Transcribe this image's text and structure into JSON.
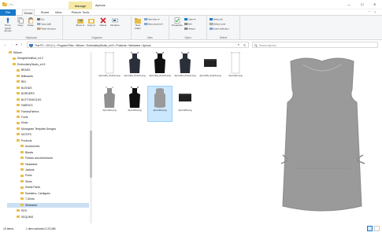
{
  "window": {
    "title": "Aprons",
    "context_tab": "Manage",
    "controls": {
      "minimize": "—",
      "maximize": "☐",
      "close": "✕"
    }
  },
  "ribbon_tabs": [
    "File",
    "Home",
    "Share",
    "View",
    "Picture Tools"
  ],
  "ribbon": {
    "clipboard": {
      "pin": "Pin to Quick access",
      "copy": "Copy",
      "paste": "Paste",
      "cut": "Cut",
      "copy_path": "Copy path",
      "paste_shortcut": "Paste shortcut",
      "label": "Clipboard"
    },
    "organize": {
      "move_to": "Move to",
      "copy_to": "Copy to",
      "delete": "Delete",
      "rename": "Rename",
      "label": "Organize"
    },
    "new": {
      "new_folder": "New folder",
      "new_item": "New item ▾",
      "easy_access": "Easy access ▾",
      "label": "New"
    },
    "open": {
      "properties": "Properties",
      "open": "Open ▾",
      "edit": "Edit",
      "history": "History",
      "label": "Open"
    },
    "select": {
      "select_all": "Select all",
      "select_none": "Select none",
      "invert": "Invert selection",
      "label": "Select"
    }
  },
  "nav": {
    "back": "←",
    "forward": "→",
    "recent": "▾",
    "up": "↑",
    "breadcrumb": [
      "This PC",
      "OS (C:)",
      "Program Files",
      "Wilcom",
      "EmbroideryStudio_e4.5",
      "Products",
      "Workwear",
      "Aprons"
    ],
    "refresh": "↻",
    "search_placeholder": "Search Aprons"
  },
  "tree": [
    {
      "label": "Wilcom",
      "depth": 0
    },
    {
      "label": "DesignWorkflow_e4.2",
      "depth": 1
    },
    {
      "label": "EmbroideryStudio_e4.5",
      "depth": 1
    },
    {
      "label": "BEADS",
      "depth": 2
    },
    {
      "label": "Billboards",
      "depth": 2
    },
    {
      "label": "BIN",
      "depth": 2
    },
    {
      "label": "BLENDS",
      "depth": 2
    },
    {
      "label": "BORDERS",
      "depth": 2
    },
    {
      "label": "BUTTONHOLES",
      "depth": 2
    },
    {
      "label": "FABRICS",
      "depth": 2
    },
    {
      "label": "FactoryFabrics",
      "depth": 2
    },
    {
      "label": "Fonts",
      "depth": 2
    },
    {
      "label": "Kiosk",
      "depth": 2
    },
    {
      "label": "Monogram Template Designs",
      "depth": 2
    },
    {
      "label": "MOTIFS",
      "depth": 2
    },
    {
      "label": "Products",
      "depth": 2
    },
    {
      "label": "Accessories",
      "depth": 3
    },
    {
      "label": "Blanks",
      "depth": 3
    },
    {
      "label": "Fitness and Activewear",
      "depth": 3
    },
    {
      "label": "Headwear",
      "depth": 3
    },
    {
      "label": "Jackets",
      "depth": 3
    },
    {
      "label": "Polos",
      "depth": 3
    },
    {
      "label": "Shirts",
      "depth": 3
    },
    {
      "label": "Sweat Pants",
      "depth": 3
    },
    {
      "label": "Sweaters- Cardigans",
      "depth": 3
    },
    {
      "label": "T-Shirts",
      "depth": 3
    },
    {
      "label": "Workwear",
      "depth": 3,
      "selected": true
    },
    {
      "label": "RES",
      "depth": 2
    },
    {
      "label": "SEQUINS",
      "depth": 2
    }
  ],
  "files": [
    {
      "name": "Apron01_thumb.png",
      "style": "white-tall"
    },
    {
      "name": "Apron02_thumb.png",
      "style": "navy-bib"
    },
    {
      "name": "Apron03_thumb.png",
      "style": "black-bib"
    },
    {
      "name": "Apron04_thumb.png",
      "style": "navy-bib"
    },
    {
      "name": "Apron05_thumb.png",
      "style": "black-waist"
    },
    {
      "name": "Apron01.png",
      "style": "white-tall"
    },
    {
      "name": "Apron02.png",
      "style": "grey-bib"
    },
    {
      "name": "Apron03.png",
      "style": "black-bib"
    },
    {
      "name": "Apron04.png",
      "style": "grey-smock",
      "selected": true
    },
    {
      "name": "Apron05.png",
      "style": "black-waist"
    }
  ],
  "status": {
    "items": "10 items",
    "selection": "1 item selected  2.23 MB"
  },
  "colors": {
    "accent": "#1979ca",
    "selection": "#cce8ff",
    "folder": "#e8be4b",
    "apron_grey": "#9a9a9a"
  }
}
